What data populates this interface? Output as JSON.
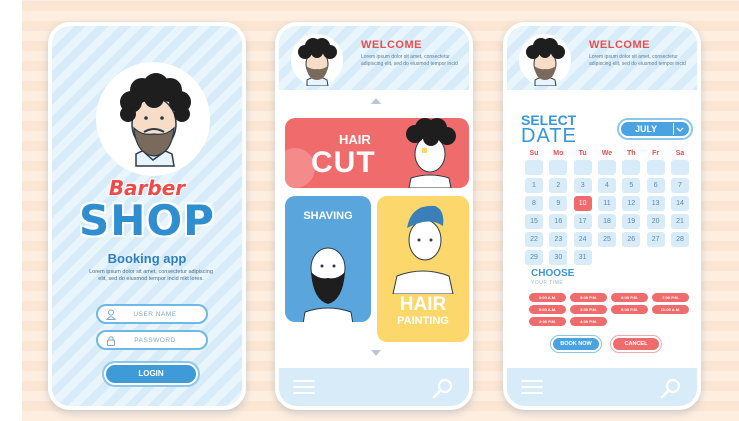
{
  "colors": {
    "brand_blue": "#3e9bd8",
    "brand_red": "#f06b6b",
    "accent_yellow": "#fcd76b",
    "phone_bg": "#dff0fa"
  },
  "login_screen": {
    "logo_line1": "Barber",
    "logo_line2": "SHOP",
    "subtitle": "Booking app",
    "description": "Lorem ipsum dolor sit amet, consectetur adipiscing elit, sed do eiusmod tempor incid nikt lores.",
    "username_placeholder": "USER NAME",
    "password_placeholder": "PASSWORD",
    "login_label": "LOGIN",
    "icons": [
      "user-icon",
      "lock-icon"
    ]
  },
  "services_screen": {
    "welcome": "WELCOME",
    "description": "Lorem ipsum dolor sit amet, consectetur adipiscing elit, sed do eiusmod tempor incid",
    "haircut_line1": "HAIR",
    "haircut_line2": "CUT",
    "shaving_label": "SHAVING",
    "painting_line1": "HAIR",
    "painting_line2": "PAINTING",
    "icons": [
      "menu-icon",
      "search-icon"
    ]
  },
  "date_screen": {
    "welcome": "WELCOME",
    "description": "Lorem ipsum dolor sit amet, consectetur adipiscing elit, sed do eiusmod tempor incid",
    "select_line1": "SELECT",
    "select_line2": "DATE",
    "month": "JULY",
    "weekdays": [
      "Su",
      "Mo",
      "Tu",
      "We",
      "Th",
      "Fr",
      "Sa"
    ],
    "selected_day": "10",
    "weeks": [
      [
        "",
        "",
        "",
        "",
        "",
        "",
        ""
      ],
      [
        "1",
        "2",
        "3",
        "4",
        "5",
        "6",
        "7"
      ],
      [
        "8",
        "9",
        "10",
        "11",
        "12",
        "13",
        "14"
      ],
      [
        "15",
        "16",
        "17",
        "18",
        "19",
        "20",
        "21"
      ],
      [
        "22",
        "23",
        "24",
        "25",
        "26",
        "27",
        "28"
      ],
      [
        "29",
        "30",
        "31",
        "",
        "",
        "",
        ""
      ]
    ],
    "choose_title": "CHOOSE",
    "choose_subtitle": "YOUR TIME",
    "times": [
      "3:00 A.M.",
      "5:00 P.M.",
      "6:00 P.M.",
      "7:00 P.M.",
      "9:00 A.M.",
      "3:00 P.M.",
      "6:00 P.M.",
      "11:00 A.M.",
      "2:00 P.M.",
      "4:00 P.M."
    ],
    "book_label": "BOOK NOW",
    "cancel_label": "CANCEL"
  }
}
